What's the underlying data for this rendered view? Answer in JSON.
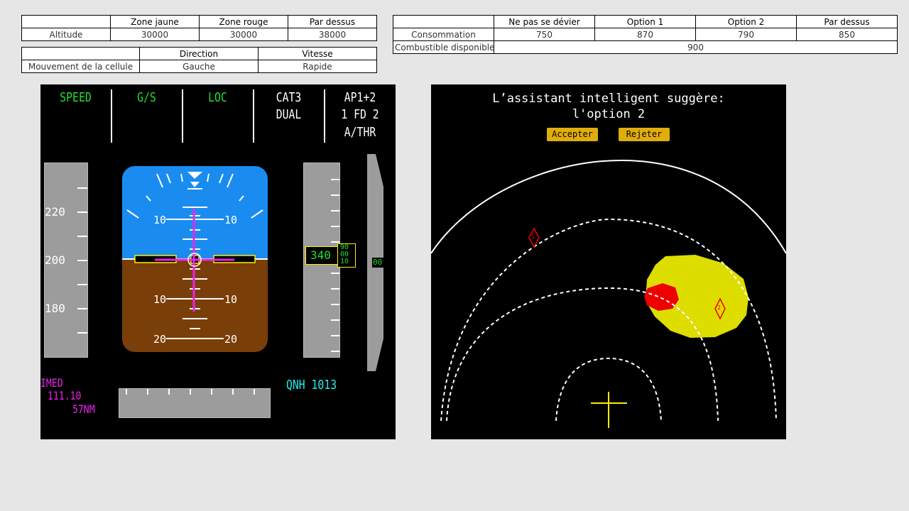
{
  "thresholds_table": {
    "headers": [
      "Zone jaune",
      "Zone rouge",
      "Par dessus"
    ],
    "row_label": "Altitude",
    "values": [
      "30000",
      "30000",
      "38000"
    ]
  },
  "cell_table": {
    "headers": [
      "Direction",
      "Vitesse"
    ],
    "row_label": "Mouvement de la cellule",
    "values": [
      "Gauche",
      "Rapide"
    ]
  },
  "fuel_table": {
    "headers": [
      "Ne pas se dévier",
      "Option 1",
      "Option 2",
      "Par dessus"
    ],
    "consumption_label": "Consommation",
    "consumption_values": [
      "750",
      "870",
      "790",
      "850"
    ],
    "fuel_label": "Combustible disponible",
    "fuel_value": "900"
  },
  "pfd": {
    "fma": {
      "speed": "SPEED",
      "gs": "G/S",
      "loc": "LOC",
      "cat_line1": "CAT3",
      "cat_line2": "DUAL",
      "ap_line1": "AP1+2",
      "ap_line2": "1 FD 2",
      "ap_line3": "A/THR"
    },
    "speed_labels": [
      "220",
      "200",
      "180"
    ],
    "pitch_labels": [
      "10",
      "10",
      "10",
      "10",
      "20",
      "20"
    ],
    "altitude_value": "340",
    "altitude_drum": [
      "90",
      "00",
      "10"
    ],
    "vs_value": "00",
    "ils_lines": [
      "IMED",
      "111.10",
      "57NM"
    ],
    "qnh": "QNH 1013",
    "colors": {
      "green": "#22dd33",
      "magenta": "#ee22ee",
      "cyan": "#22eeee",
      "sky": "#1a8cf0",
      "ground": "#7a3e08",
      "yellow": "#ffee00"
    }
  },
  "nd": {
    "title_line1": "L’assistant intelligent suggère:",
    "title_line2": "l'option 2",
    "accept_label": "Accepter",
    "reject_label": "Rejeter",
    "waypoint_1": "1",
    "waypoint_2": "2",
    "colors": {
      "storm_yellow": "#dddd00",
      "storm_red": "#ee0000",
      "button": "#e0ad0c"
    }
  }
}
